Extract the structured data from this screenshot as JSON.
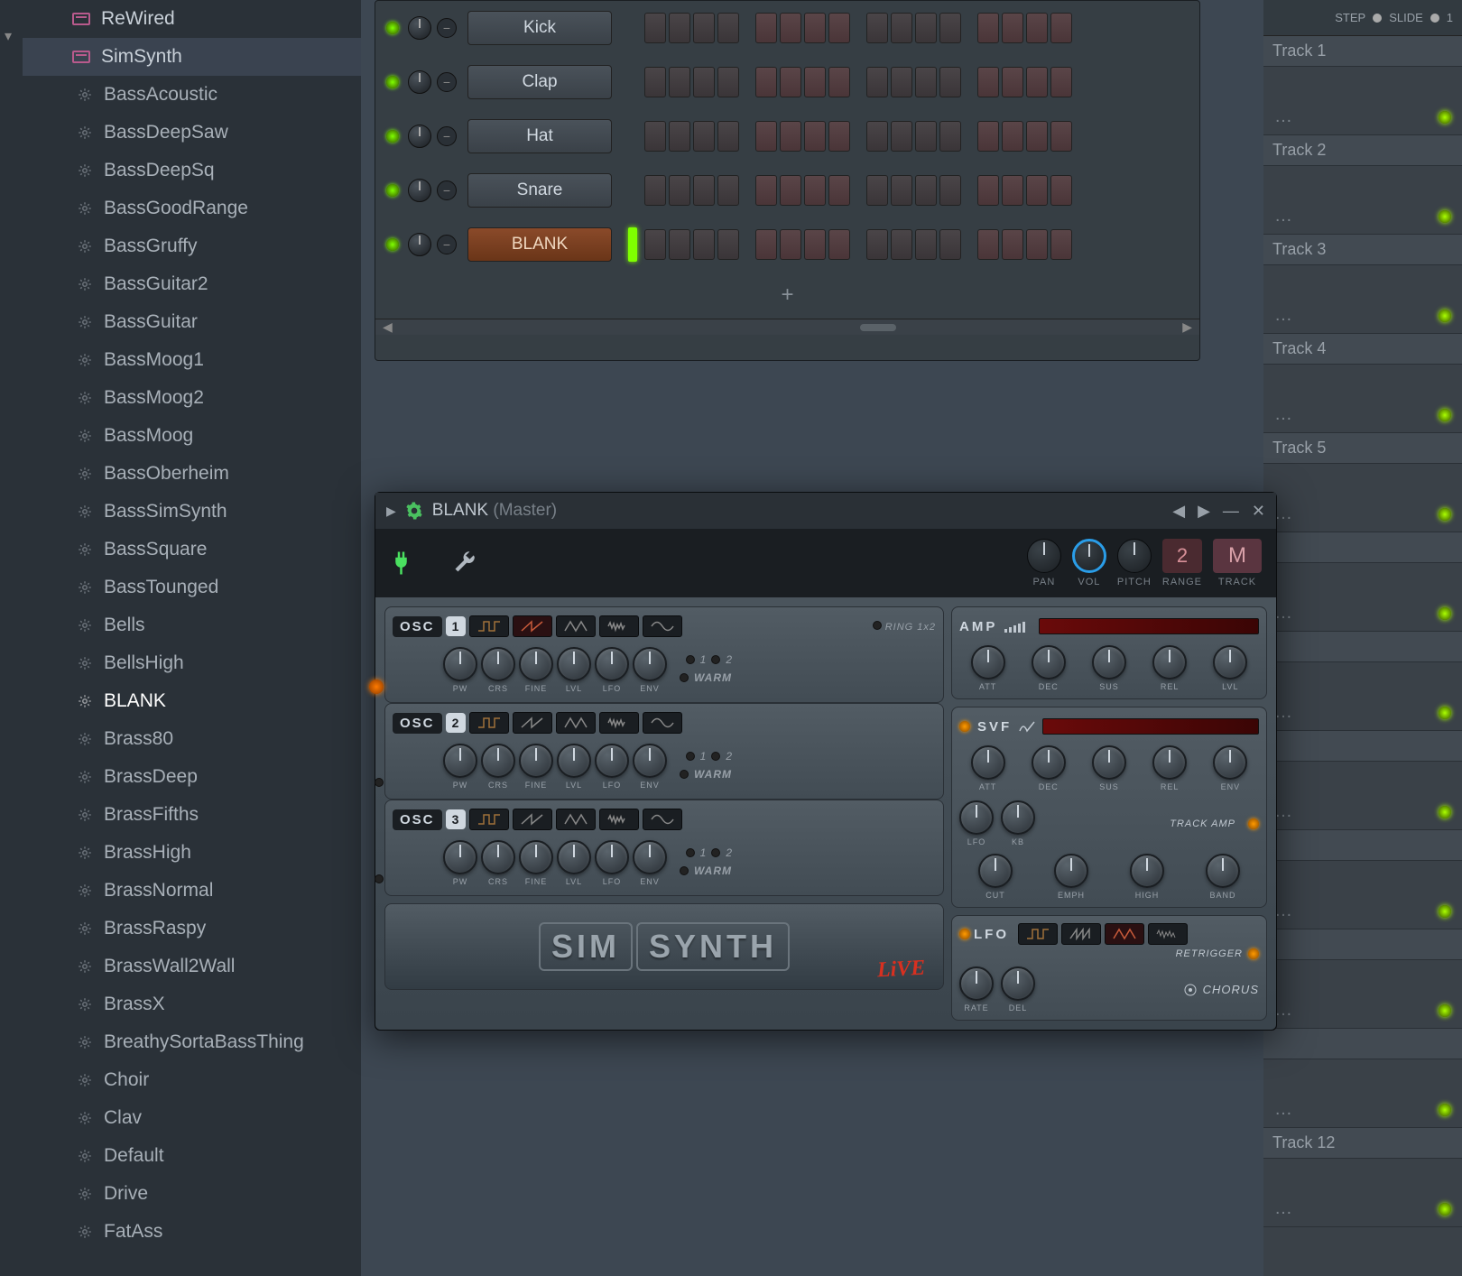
{
  "sidebar": {
    "folders": [
      {
        "name": "ReWired",
        "selected": false
      },
      {
        "name": "SimSynth",
        "selected": true
      }
    ],
    "presets": [
      "BassAcoustic",
      "BassDeepSaw",
      "BassDeepSq",
      "BassGoodRange",
      "BassGruffy",
      "BassGuitar2",
      "BassGuitar",
      "BassMoog1",
      "BassMoog2",
      "BassMoog",
      "BassOberheim",
      "BassSimSynth",
      "BassSquare",
      "BassTounged",
      "Bells",
      "BellsHigh",
      "BLANK",
      "Brass80",
      "BrassDeep",
      "BrassFifths",
      "BrassHigh",
      "BrassNormal",
      "BrassRaspy",
      "BrassWall2Wall",
      "BrassX",
      "BreathySortaBassThing",
      "Choir",
      "Clav",
      "Default",
      "Drive",
      "FatAss"
    ],
    "selected_preset": "BLANK"
  },
  "channel_rack": {
    "channels": [
      {
        "name": "Kick",
        "selected": false
      },
      {
        "name": "Clap",
        "selected": false
      },
      {
        "name": "Hat",
        "selected": false
      },
      {
        "name": "Snare",
        "selected": false
      },
      {
        "name": "BLANK",
        "selected": true
      }
    ],
    "add_label": "+",
    "steps": 16
  },
  "playlist": {
    "header": {
      "step": "STEP",
      "slide": "SLIDE",
      "count": "1"
    },
    "tracks": [
      "Track 1",
      "Track 2",
      "Track 3",
      "Track 4",
      "Track 5",
      "",
      "",
      "",
      "",
      "",
      "",
      "Track 12"
    ]
  },
  "plugin": {
    "title": "BLANK",
    "master": "(Master)",
    "toolbar": {
      "pan": "PAN",
      "vol": "VOL",
      "pitch": "PITCH",
      "range": "RANGE",
      "track": "TRACK",
      "range_val": "2",
      "track_val": "M"
    },
    "osc": {
      "label": "OSC",
      "knob_labels": [
        "PW",
        "CRS",
        "FINE",
        "LVL",
        "LFO",
        "ENV"
      ],
      "ring": "RING 1x2",
      "warm": "WARM",
      "one": "1",
      "two": "2"
    },
    "amp": {
      "label": "AMP",
      "knobs": [
        "ATT",
        "DEC",
        "SUS",
        "REL",
        "LVL"
      ]
    },
    "svf": {
      "label": "SVF",
      "knobs": [
        "ATT",
        "DEC",
        "SUS",
        "REL",
        "ENV"
      ],
      "extra1": [
        "LFO",
        "KB"
      ],
      "extra2": [
        "CUT",
        "EMPH",
        "HIGH",
        "BAND"
      ],
      "track_amp": "TRACK AMP"
    },
    "lfo": {
      "label": "LFO",
      "knobs": [
        "RATE",
        "DEL"
      ],
      "retrigger": "RETRIGGER",
      "chorus": "CHORUS"
    },
    "logo": {
      "sim": "SIM",
      "synth": "SYNTH",
      "live": "LiVE"
    }
  }
}
